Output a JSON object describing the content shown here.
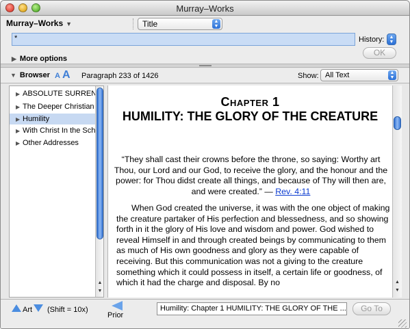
{
  "window": {
    "title": "Murray–Works"
  },
  "search": {
    "module": "Murray–Works",
    "field_select": "Title",
    "query": "*",
    "history_label": "History:",
    "ok_label": "OK",
    "more_options_label": "More options"
  },
  "browser": {
    "label": "Browser",
    "font_small": "A",
    "font_large": "A",
    "paragraph_label": "Paragraph 233  of 1426",
    "show_label": "Show:",
    "show_value": "All Text",
    "tree": [
      {
        "label": "ABSOLUTE SURRENDER",
        "selected": false
      },
      {
        "label": "The Deeper Christian Life",
        "selected": false
      },
      {
        "label": "Humility",
        "selected": true
      },
      {
        "label": "With Christ In the School of Prayer",
        "selected": false
      },
      {
        "label": "Other Addresses",
        "selected": false
      }
    ]
  },
  "document": {
    "chapter_label": "Chapter 1",
    "chapter_title": "HUMILITY: THE GLORY OF THE CREATURE",
    "epigraph": "“They shall cast their crowns before the throne, so saying: Worthy art Thou, our Lord and our God, to receive the glory, and the honour and the power: for Thou didst create all things, and because of Thy will then are, and were created.” —",
    "epigraph_ref": "Rev. 4:11",
    "paragraph": "When God created the universe, it was with the one object of making the creature partaker of His perfection and blessedness, and so showing forth in it the glory of His love and wisdom and power. God wished to reveal Himself in and through created beings by communicating to them as much of His own goodness and glory as they were capable of receiving. But this communication was not a giving to the creature something which it could possess in itself, a certain life or goodness, of which it had the charge and disposal. By no"
  },
  "bottom": {
    "art_label": "Art",
    "shift_note": "(Shift = 10x)",
    "prior_label": "Prior",
    "location": "Humility: Chapter 1 HUMILITY: THE GLORY OF THE ...",
    "goto_label": "Go To"
  },
  "colors": {
    "accent": "#3f7fd6",
    "selection": "#c7d9f2",
    "search_field": "#c9dcf5",
    "link": "#0b3bd0"
  }
}
